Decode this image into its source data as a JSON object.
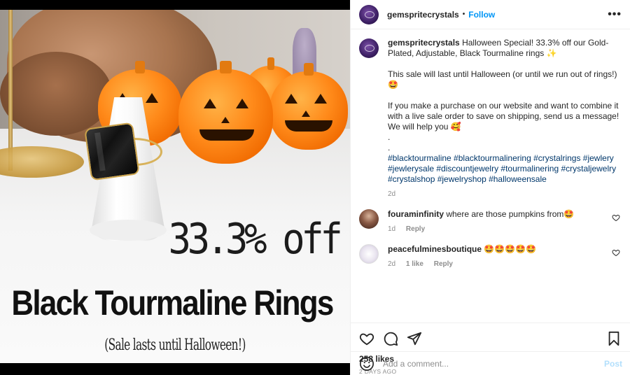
{
  "image": {
    "off_text": "33.3% off",
    "headline": "Black Tourmaline Rings",
    "sub": "(Sale lasts until Halloween!)"
  },
  "header": {
    "username": "gemspritecrystals",
    "separator": "•",
    "follow_label": "Follow",
    "more_label": "•••"
  },
  "caption": {
    "username": "gemspritecrystals",
    "para1": "Halloween Special! 33.3% off our Gold-Plated, Adjustable, Black Tourmaline rings ✨",
    "para2": "This sale will last until Halloween (or until we run out of rings!) 🤩",
    "para3": "If you make a purchase on our website and want to combine it with a live sale order to save on shipping, send us a message! We will help you 🥰",
    "dot1": ".",
    "dot2": ".",
    "hashtags": "#blacktourmaline #blacktourmalinering #crystalrings #jewlery #jewlerysale #discountjewelry #tourmalinering #crystaljewelry #crystalshop #jewelryshop #halloweensale",
    "age": "2d"
  },
  "comments": [
    {
      "username": "fouraminfinity",
      "text": "where are those pumpkins from🤩",
      "age": "1d",
      "likes": "",
      "reply": "Reply"
    },
    {
      "username": "peacefulminesboutique",
      "text": "🤩🤩🤩🤩🤩",
      "age": "2d",
      "likes": "1 like",
      "reply": "Reply"
    }
  ],
  "likes_label": "258 likes",
  "date_label": "2 DAYS AGO",
  "add_comment": {
    "placeholder": "Add a comment...",
    "post_label": "Post"
  },
  "icons": [
    "heart-icon",
    "comment-icon",
    "share-icon",
    "bookmark-icon",
    "emoji-icon"
  ]
}
